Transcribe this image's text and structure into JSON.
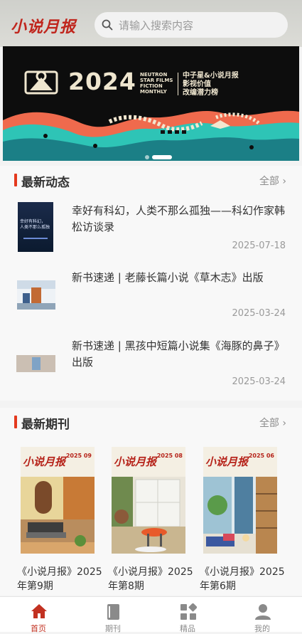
{
  "header": {
    "logo_text": "小说月报",
    "search_placeholder": "请输入搜索内容"
  },
  "banner": {
    "year": "2024",
    "english_lines": [
      "NEUTRON",
      "STAR FILMS",
      "FICTION",
      "MONTHLY"
    ],
    "chinese_lines": [
      "中子星&小说月报",
      "影视价值",
      "改编潜力榜"
    ],
    "slide_count": 2,
    "active_slide": 2
  },
  "news_section": {
    "title": "最新动态",
    "more_label": "全部",
    "items": [
      {
        "title": "幸好有科幻，人类不那么孤独——科幻作家韩松访谈录",
        "date": "2025-07-18",
        "thumb_text": [
          "幸好有科幻，",
          "人类不那么孤独"
        ]
      },
      {
        "title": "新书速递 | 老藤长篇小说《草木志》出版",
        "date": "2025-03-24"
      },
      {
        "title": "新书速递 | 黑孩中短篇小说集《海豚的鼻子》出版",
        "date": "2025-03-24"
      }
    ]
  },
  "journal_section": {
    "title": "最新期刊",
    "more_label": "全部",
    "items": [
      {
        "caption": "《小说月报》2025年第9期",
        "cover_title": "小说月报",
        "cover_issue": "2025 09"
      },
      {
        "caption": "《小说月报》2025年第8期",
        "cover_title": "小说月报",
        "cover_issue": "2025 08"
      },
      {
        "caption": "《小说月报》2025年第6期",
        "cover_title": "小说月报",
        "cover_issue": "2025 06"
      }
    ]
  },
  "tabbar": {
    "items": [
      {
        "label": "首页",
        "icon": "home-icon",
        "active": true
      },
      {
        "label": "期刊",
        "icon": "book-icon",
        "active": false
      },
      {
        "label": "精品",
        "icon": "grid-icon",
        "active": false
      },
      {
        "label": "我的",
        "icon": "user-icon",
        "active": false
      }
    ]
  },
  "colors": {
    "accent": "#e4391e",
    "brand_red": "#c0261d",
    "active_tab": "#c23121"
  }
}
